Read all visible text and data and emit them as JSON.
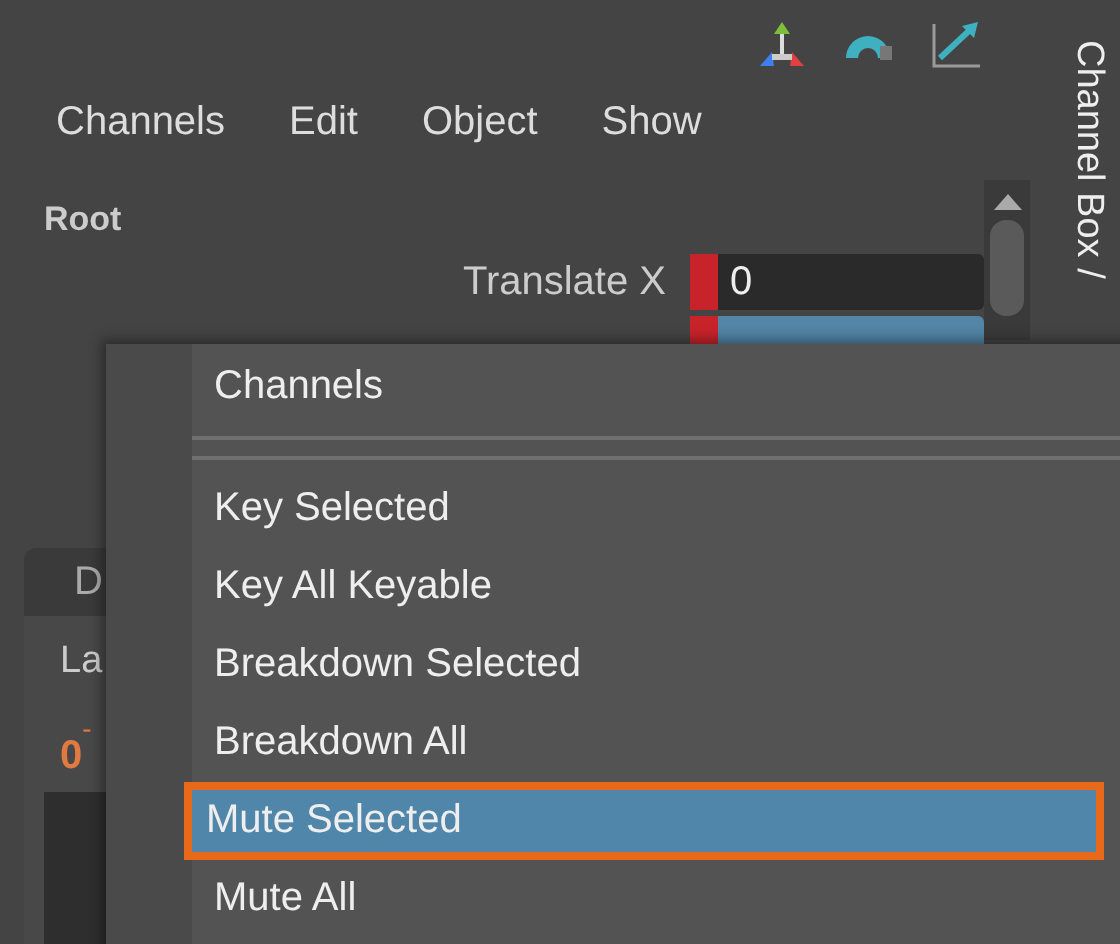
{
  "vertical_tab": "Channel Box /",
  "menu_bar": [
    {
      "label": "Channels"
    },
    {
      "label": "Edit"
    },
    {
      "label": "Object"
    },
    {
      "label": "Show"
    }
  ],
  "node": "Root",
  "attributes": [
    {
      "name": "Translate X",
      "value": "0",
      "selected": false
    },
    {
      "selected": true
    }
  ],
  "background_panel": {
    "tab": "D",
    "label": "La",
    "value": "0",
    "mark": "-"
  },
  "context_menu": {
    "title": "Channels",
    "items": [
      {
        "label": "Key Selected",
        "selected": false
      },
      {
        "label": "Key All Keyable",
        "selected": false
      },
      {
        "label": "Breakdown Selected",
        "selected": false
      },
      {
        "label": "Breakdown All",
        "selected": false
      },
      {
        "label": "Mute Selected",
        "selected": true
      },
      {
        "label": "Mute All",
        "selected": false
      }
    ]
  }
}
